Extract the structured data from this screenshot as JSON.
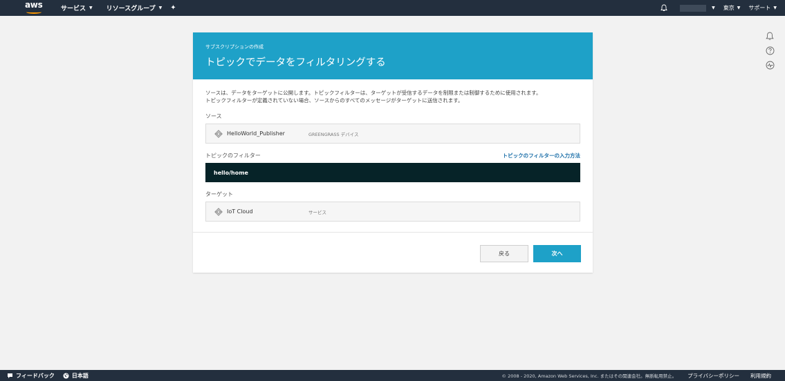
{
  "topnav": {
    "logo": "aws",
    "services": "サービス",
    "resource_groups": "リソースグループ",
    "region": "東京",
    "support": "サポート"
  },
  "panel": {
    "subtitle": "サブスクリプションの作成",
    "title": "トピックでデータをフィルタリングする",
    "description_line1": "ソースは、データをターゲットに公開します。トピックフィルターは、ターゲットが受信するデータを制限または制御するために使用されます。",
    "description_line2": "トピックフィルターが定義されていない場合、ソースからのすべてのメッセージがターゲットに送信されます。",
    "source": {
      "label": "ソース",
      "name": "HelloWorld_Publisher",
      "type": "GREENGRASS デバイス"
    },
    "topic": {
      "label": "トピックのフィルター",
      "help_link": "トピックのフィルターの入力方法",
      "value": "hello/home"
    },
    "target": {
      "label": "ターゲット",
      "name": "IoT Cloud",
      "type": "サービス"
    },
    "back_button": "戻る",
    "next_button": "次へ"
  },
  "footer": {
    "feedback": "フィードバック",
    "language": "日本語",
    "copyright": "© 2008 - 2020, Amazon Web Services, Inc. またはその関連会社。無断転用禁止。",
    "privacy": "プライバシーポリシー",
    "terms": "利用規約"
  },
  "icons": {
    "bell": "bell-icon",
    "help": "help-circle-icon",
    "status": "status-icon",
    "pin": "pin-icon",
    "greengrass": "greengrass-icon",
    "feedback": "speech-bubble-icon",
    "globe": "globe-icon"
  },
  "colors": {
    "nav_bg": "#232f3e",
    "header_bg": "#1ea1c8",
    "topic_bg": "#062328",
    "link": "#1a6ea8"
  }
}
